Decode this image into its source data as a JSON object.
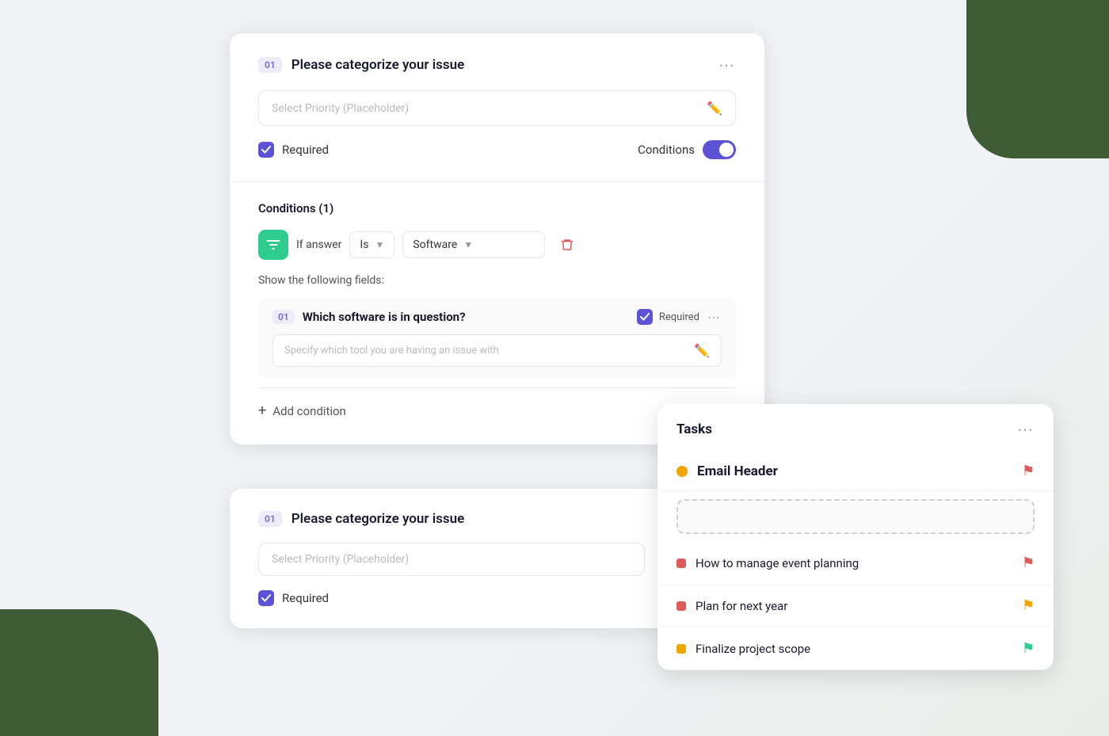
{
  "colors": {
    "accent_purple": "#5b52d6",
    "accent_green": "#2ecc8f",
    "red": "#e05a5a",
    "yellow": "#f0a500",
    "bg": "#f0f2f5"
  },
  "form_card_1": {
    "section1": {
      "step_badge": "01",
      "title": "Please categorize your issue",
      "placeholder": "Select Priority (Placeholder)",
      "required_label": "Required",
      "conditions_label": "Conditions",
      "dots_label": "⋯"
    },
    "conditions_block": {
      "title": "Conditions (1)",
      "if_answer_label": "If answer",
      "is_dropdown_value": "Is",
      "software_dropdown_value": "Software",
      "show_fields_label": "Show the following fields:",
      "nested_step_badge": "01",
      "nested_title": "Which software is in question?",
      "nested_required_label": "Required",
      "nested_placeholder": "Specify which tool you are having an issue with",
      "add_condition_label": "Add condition"
    }
  },
  "form_card_2": {
    "step_badge": "01",
    "title": "Please categorize your issue",
    "placeholder": "Select Priority (Placeholder)",
    "required_label": "Required"
  },
  "tasks_panel": {
    "title": "Tasks",
    "dots_label": "⋯",
    "email_header_title": "Email Header",
    "tasks": [
      {
        "label": "How to manage event planning",
        "dot_color": "red",
        "flag_color": "red"
      },
      {
        "label": "Plan for next year",
        "dot_color": "red",
        "flag_color": "yellow"
      },
      {
        "label": "Finalize project scope",
        "dot_color": "yellow",
        "flag_color": "green"
      }
    ]
  }
}
